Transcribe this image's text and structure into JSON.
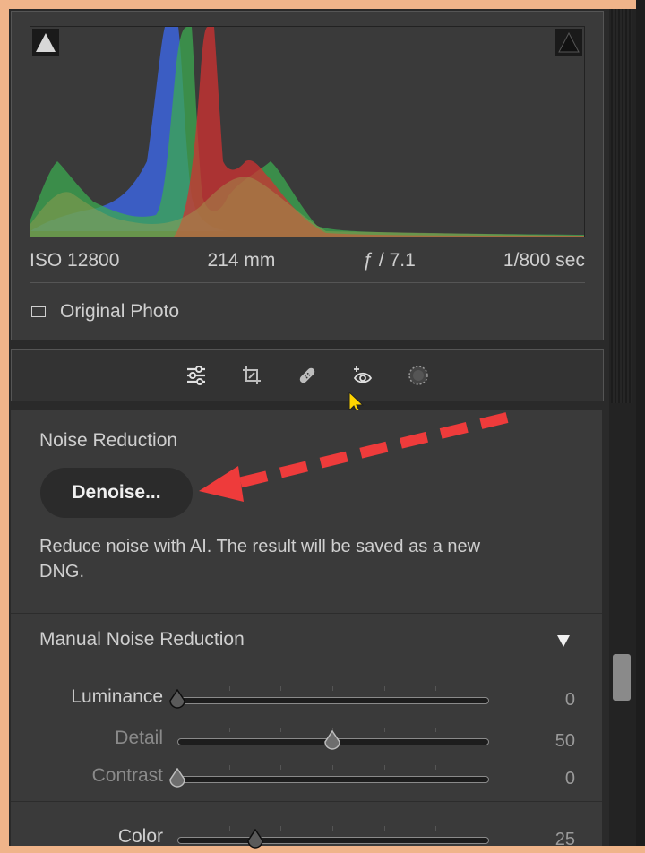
{
  "exif": {
    "iso": "ISO 12800",
    "focal_length": "214 mm",
    "aperture": "ƒ / 7.1",
    "shutter": "1/800 sec"
  },
  "original_photo_label": "Original Photo",
  "toolbar": {
    "icons": [
      "edit-sliders-icon",
      "crop-icon",
      "healing-icon",
      "red-eye-icon",
      "masking-icon"
    ]
  },
  "noise_reduction": {
    "title": "Noise Reduction",
    "denoise_label": "Denoise...",
    "description": "Reduce noise with AI. The result will be saved as a new DNG."
  },
  "manual": {
    "title": "Manual Noise Reduction",
    "sliders": [
      {
        "label": "Luminance",
        "value": "0",
        "level": 0,
        "enabled": true
      },
      {
        "label": "Detail",
        "value": "50",
        "level": 0.5,
        "enabled": false
      },
      {
        "label": "Contrast",
        "value": "0",
        "level": 0,
        "enabled": false
      },
      {
        "label": "Color",
        "value": "25",
        "level": 0.25,
        "enabled": true
      }
    ]
  },
  "colors": {
    "background": "#f0b48a",
    "panel": "#3a3a3a",
    "annotation_arrow": "#ff4444"
  }
}
